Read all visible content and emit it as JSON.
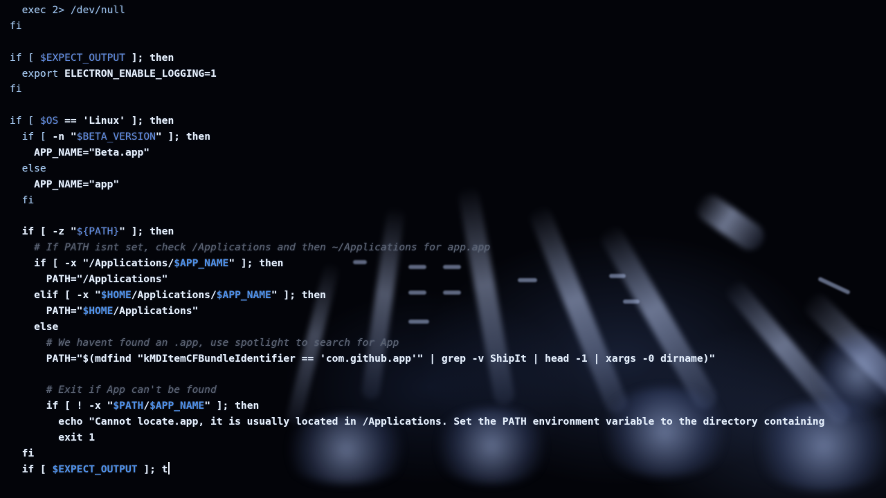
{
  "editor": {
    "language": "shell",
    "indent_unit": "  ",
    "lines": [
      {
        "indent": 1,
        "tokens": [
          {
            "t": "exec ",
            "c": "kw"
          },
          {
            "t": "2> /dev/null",
            "c": "dim"
          }
        ]
      },
      {
        "indent": 0,
        "tokens": [
          {
            "t": "fi",
            "c": "kw"
          }
        ]
      },
      {
        "indent": 0,
        "tokens": []
      },
      {
        "indent": 0,
        "tokens": [
          {
            "t": "if [ ",
            "c": "kw"
          },
          {
            "t": "$EXPECT_OUTPUT",
            "c": "var"
          },
          {
            "t": " ]; then",
            "c": "plain"
          }
        ]
      },
      {
        "indent": 1,
        "tokens": [
          {
            "t": "export ",
            "c": "kw"
          },
          {
            "t": "ELECTRON_ENABLE_LOGGING=1",
            "c": "plain"
          }
        ]
      },
      {
        "indent": 0,
        "tokens": [
          {
            "t": "fi",
            "c": "kw"
          }
        ]
      },
      {
        "indent": 0,
        "tokens": []
      },
      {
        "indent": 0,
        "tokens": [
          {
            "t": "if [ ",
            "c": "kw"
          },
          {
            "t": "$OS",
            "c": "var"
          },
          {
            "t": " == 'Linux' ]; then",
            "c": "plain"
          }
        ]
      },
      {
        "indent": 1,
        "tokens": [
          {
            "t": "if [ ",
            "c": "kw"
          },
          {
            "t": "-n \"",
            "c": "plain"
          },
          {
            "t": "$BETA_VERSION",
            "c": "var"
          },
          {
            "t": "\" ]; then",
            "c": "plain"
          }
        ]
      },
      {
        "indent": 2,
        "tokens": [
          {
            "t": "APP_NAME=\"Beta.app\"",
            "c": "plain"
          }
        ]
      },
      {
        "indent": 1,
        "tokens": [
          {
            "t": "else",
            "c": "kw"
          }
        ]
      },
      {
        "indent": 2,
        "tokens": [
          {
            "t": "APP_NAME=\"app\"",
            "c": "plain"
          }
        ]
      },
      {
        "indent": 1,
        "tokens": [
          {
            "t": "fi",
            "c": "kw"
          }
        ]
      },
      {
        "indent": 0,
        "tokens": []
      },
      {
        "indent": 1,
        "tokens": [
          {
            "t": "if [ -z \"",
            "c": "plain"
          },
          {
            "t": "${PATH}",
            "c": "var"
          },
          {
            "t": "\" ]; then",
            "c": "plain"
          }
        ]
      },
      {
        "indent": 2,
        "tokens": [
          {
            "t": "# If PATH isnt set, check /Applications and then ~/Applications for app.app",
            "c": "cmt"
          }
        ]
      },
      {
        "indent": 2,
        "tokens": [
          {
            "t": "if [ -x \"/Applications/",
            "c": "plain"
          },
          {
            "t": "$APP_NAME",
            "c": "var-bright"
          },
          {
            "t": "\" ]; then",
            "c": "plain"
          }
        ]
      },
      {
        "indent": 3,
        "tokens": [
          {
            "t": "PATH=\"/Applications\"",
            "c": "plain"
          }
        ]
      },
      {
        "indent": 2,
        "tokens": [
          {
            "t": "elif [ -x \"",
            "c": "plain"
          },
          {
            "t": "$HOME",
            "c": "var-bright"
          },
          {
            "t": "/Applications/",
            "c": "plain"
          },
          {
            "t": "$APP_NAME",
            "c": "var-bright"
          },
          {
            "t": "\" ]; then",
            "c": "plain"
          }
        ]
      },
      {
        "indent": 3,
        "tokens": [
          {
            "t": "PATH=\"",
            "c": "plain"
          },
          {
            "t": "$HOME",
            "c": "var-bright"
          },
          {
            "t": "/Applications\"",
            "c": "plain"
          }
        ]
      },
      {
        "indent": 2,
        "tokens": [
          {
            "t": "else",
            "c": "plain"
          }
        ]
      },
      {
        "indent": 3,
        "tokens": [
          {
            "t": "# We havent found an .app, use spotlight to search for App",
            "c": "cmt"
          }
        ]
      },
      {
        "indent": 3,
        "tokens": [
          {
            "t": "PATH=\"$(mdfind \"kMDItemCFBundleIdentifier == 'com.github.app'\" | grep -v ShipIt | head -1 | xargs -0 dirname)\"",
            "c": "plain"
          }
        ]
      },
      {
        "indent": 0,
        "tokens": []
      },
      {
        "indent": 3,
        "tokens": [
          {
            "t": "# Exit if App can't be found",
            "c": "cmt"
          }
        ]
      },
      {
        "indent": 3,
        "tokens": [
          {
            "t": "if [ ! -x \"",
            "c": "plain"
          },
          {
            "t": "$PATH",
            "c": "var-bright"
          },
          {
            "t": "/",
            "c": "plain"
          },
          {
            "t": "$APP_NAME",
            "c": "var-bright"
          },
          {
            "t": "\" ]; then",
            "c": "plain"
          }
        ]
      },
      {
        "indent": 4,
        "tokens": [
          {
            "t": "echo \"Cannot locate.app, it is usually located in /Applications. Set the PATH environment variable to the directory containing",
            "c": "plain"
          }
        ]
      },
      {
        "indent": 4,
        "tokens": [
          {
            "t": "exit 1",
            "c": "plain"
          }
        ]
      },
      {
        "indent": 1,
        "tokens": [
          {
            "t": "fi",
            "c": "plain"
          }
        ]
      },
      {
        "indent": 1,
        "tokens": [
          {
            "t": "if [ ",
            "c": "plain"
          },
          {
            "t": "$EXPECT_OUTPUT",
            "c": "var-bright"
          },
          {
            "t": " ]; t",
            "c": "plain"
          }
        ],
        "cursor": true
      }
    ]
  },
  "background": {
    "description": "backlit keyboard with hands, blurred, dark blue tone",
    "accent": "#a8bff0"
  },
  "colors": {
    "background": "#030409",
    "keyword": "#9fc2e8",
    "variable": "#5d86d8",
    "comment": "#5a6170",
    "text": "#dfe8f4"
  }
}
